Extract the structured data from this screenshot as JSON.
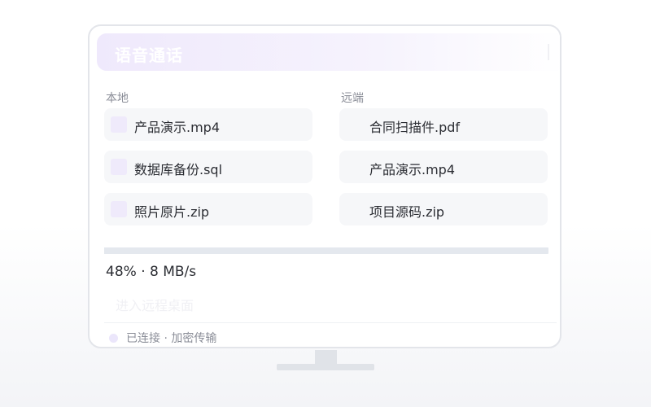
{
  "window": {
    "title": "语音通话"
  },
  "local": {
    "label": "本地",
    "files": [
      {
        "name": "产品演示.mp4"
      },
      {
        "name": "数据库备份.sql"
      },
      {
        "name": "照片原片.zip"
      }
    ]
  },
  "remote": {
    "label": "远端",
    "files": [
      {
        "name": "合同扫描件.pdf"
      },
      {
        "name": "产品演示.mp4"
      },
      {
        "name": "项目源码.zip"
      }
    ]
  },
  "transfer": {
    "progress_percent": 48,
    "summary": "48% · 8 MB/s"
  },
  "actions": {
    "enter_remote_desktop": "进入远程桌面"
  },
  "status": {
    "text": "已连接 · 加密传输"
  },
  "colors": {
    "accent_light": "#efeafb",
    "panel_bg": "#f6f7f9",
    "text_primary": "#2b2d33",
    "text_secondary": "#8b8e98"
  }
}
